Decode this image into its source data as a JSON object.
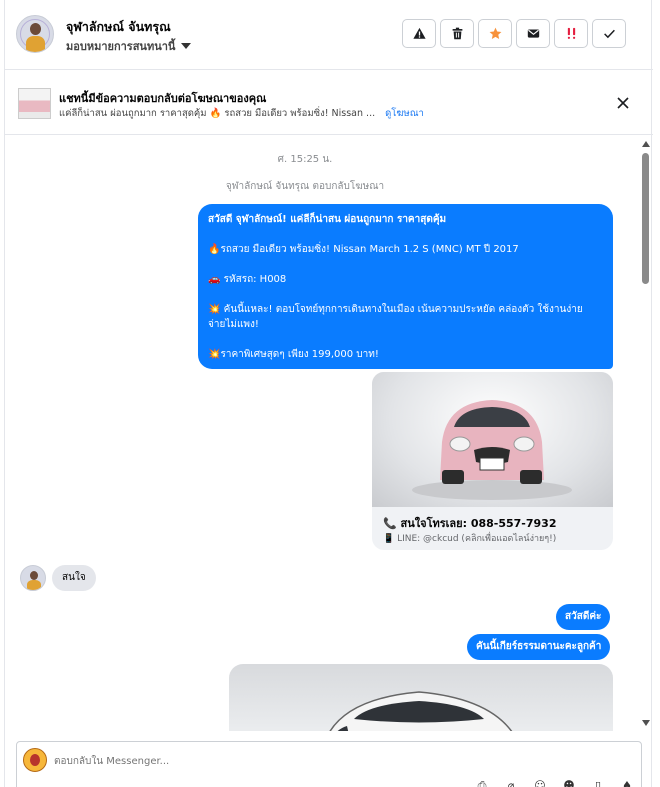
{
  "header": {
    "name": "จุฬาลักษณ์ จันทรุณ",
    "assign_label": "มอบหมายการสนทนานี้"
  },
  "actions": [
    {
      "name": "report-spam-button",
      "icon": "warning-icon",
      "color": "#1c1e21"
    },
    {
      "name": "delete-button",
      "icon": "trash-icon",
      "color": "#1c1e21"
    },
    {
      "name": "star-button",
      "icon": "star-icon",
      "color": "#f7923b"
    },
    {
      "name": "mark-unread-button",
      "icon": "envelope-icon",
      "color": "#1c1e21"
    },
    {
      "name": "mark-important-button",
      "icon": "exclamation-icon",
      "color": "#e41e3f"
    },
    {
      "name": "mark-done-button",
      "icon": "check-icon",
      "color": "#1c1e21"
    }
  ],
  "ad_banner": {
    "title": "แชทนี้มีข้อความตอบกลับต่อโฆษณาของคุณ",
    "preview": "แค่ลีก็น่าสน ผ่อนถูกมาก ราคาสุดคุ้ม 🔥 รถสวย มือเดียว พร้อมซิ่ง! Nissan ...",
    "view_ad_label": "ดูโฆษณา"
  },
  "conversation": {
    "timestamp": "ศ. 15:25 น.",
    "reply_note": "จุฬาลักษณ์ จันทรุณ ตอบกลับโฆษณา",
    "ad_message": {
      "line1": "สวัสดี จุฬาลักษณ์! แค่ลีก็น่าสน ผ่อนถูกมาก ราคาสุดคุ้ม",
      "line2": "🔥รถสวย มือเดียว พร้อมซิ่ง! Nissan March 1.2 S (MNC) MT ปี 2017",
      "line3": "🚗 รหัสรถ: H008",
      "line4": "💥 คันนี้แหละ! ตอบโจทย์ทุกการเดินทางในเมือง เน้นความประหยัด คล่องตัว ใช้งานง่าย จ่ายไม่แพง!",
      "line5": "💥ราคาพิเศษสุดๆ เพียง 199,000 บาท!"
    },
    "card": {
      "phone_text": "📞 สนใจโทรเลย: 088-557-7932",
      "line_text": "📱 LINE: @ckcud (คลิกเพื่อแอดไลน์ง่ายๆ!)",
      "car_color": "#e8b4bf"
    },
    "incoming_message": "สนใจ",
    "reply1": "สวัสดีค่ะ",
    "reply2": "คันนี้เกียร์ธรรมดานะคะลูกค้า"
  },
  "composer": {
    "placeholder": "ตอบกลับใน Messenger..."
  },
  "colors": {
    "accent": "#0a7cff",
    "incoming_bubble": "#e4e6eb"
  }
}
